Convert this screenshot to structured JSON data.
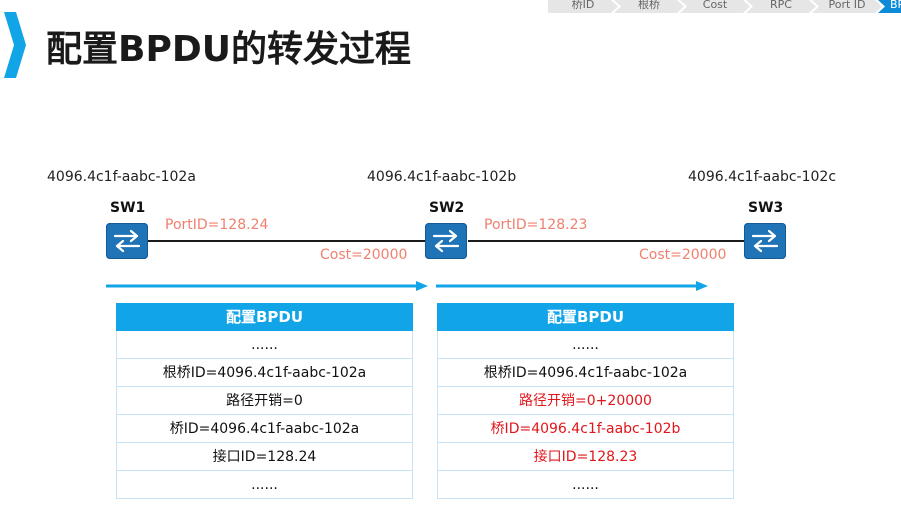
{
  "nav": {
    "items": [
      "桥ID",
      "根桥",
      "Cost",
      "RPC",
      "Port ID",
      "BPDU"
    ],
    "active_index": 5
  },
  "title": "配置BPDU的转发过程",
  "colors": {
    "accent": "#11a5e8",
    "switch": "#1f73b7",
    "highlight_red": "#e0161c",
    "label_red": "#f08070"
  },
  "switches": [
    {
      "name": "SW1",
      "bridge_id": "4096.4c1f-aabc-102a"
    },
    {
      "name": "SW2",
      "bridge_id": "4096.4c1f-aabc-102b"
    },
    {
      "name": "SW3",
      "bridge_id": "4096.4c1f-aabc-102c"
    }
  ],
  "links": [
    {
      "port_id": "PortID=128.24",
      "cost": "Cost=20000"
    },
    {
      "port_id": "PortID=128.23",
      "cost": "Cost=20000"
    }
  ],
  "tables": [
    {
      "header": "配置BPDU",
      "rows": [
        {
          "text": "......",
          "highlight": false
        },
        {
          "text": "根桥ID=4096.4c1f-aabc-102a",
          "highlight": false
        },
        {
          "text": "路径开销=0",
          "highlight": false
        },
        {
          "text": "桥ID=4096.4c1f-aabc-102a",
          "highlight": false
        },
        {
          "text": "接口ID=128.24",
          "highlight": false
        },
        {
          "text": "......",
          "highlight": false
        }
      ]
    },
    {
      "header": "配置BPDU",
      "rows": [
        {
          "text": "......",
          "highlight": false
        },
        {
          "text": "根桥ID=4096.4c1f-aabc-102a",
          "highlight": false
        },
        {
          "text": "路径开销=0+20000",
          "highlight": true
        },
        {
          "text": "桥ID=4096.4c1f-aabc-102b",
          "highlight": true
        },
        {
          "text": "接口ID=128.23",
          "highlight": true
        },
        {
          "text": "......",
          "highlight": false
        }
      ]
    }
  ]
}
